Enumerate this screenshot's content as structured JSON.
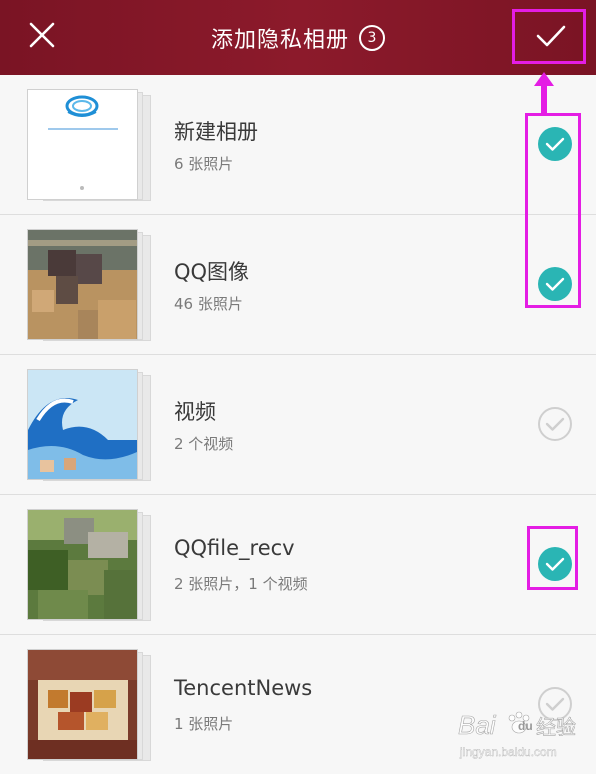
{
  "header": {
    "title": "添加隐私相册",
    "selected_count": "3",
    "close_icon": "close-icon",
    "confirm_icon": "checkmark-icon"
  },
  "albums": [
    {
      "name": "新建相册",
      "count_text": "6 张照片",
      "selected": true
    },
    {
      "name": "QQ图像",
      "count_text": "46 张照片",
      "selected": true
    },
    {
      "name": "视频",
      "count_text": "2 个视频",
      "selected": false
    },
    {
      "name": "QQfile_recv",
      "count_text": "2 张照片，1 个视频",
      "selected": true
    },
    {
      "name": "TencentNews",
      "count_text": "1 张照片",
      "selected": false
    }
  ],
  "colors": {
    "header": "#861a2a",
    "selected_check": "#2ab5b4",
    "highlight": "#e41de4"
  },
  "watermark": {
    "brand": "Bai",
    "paw": "du",
    "suffix": "经验",
    "url": "jingyan.baidu.com"
  }
}
